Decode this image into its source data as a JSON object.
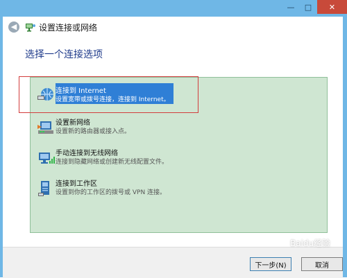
{
  "window": {
    "controls": {
      "minimize": "—",
      "maximize": "□",
      "close": "✕"
    }
  },
  "header": {
    "back_icon": "back-arrow-icon",
    "title": "设置连接或网络"
  },
  "heading": "选择一个连接选项",
  "options": [
    {
      "title": "连接到 Internet",
      "desc": "设置宽带或拨号连接，连接到 Internet。",
      "icon": "globe-network-icon",
      "selected": true
    },
    {
      "title": "设置新网络",
      "desc": "设置新的路由器或接入点。",
      "icon": "router-icon",
      "selected": false
    },
    {
      "title": "手动连接到无线网络",
      "desc": "连接到隐藏网络或创建新无线配置文件。",
      "icon": "wireless-computer-icon",
      "selected": false
    },
    {
      "title": "连接到工作区",
      "desc": "设置到你的工作区的拨号或 VPN 连接。",
      "icon": "workplace-icon",
      "selected": false
    }
  ],
  "buttons": {
    "next": "下一步(N)",
    "cancel": "取消"
  },
  "watermark": "Baidu经验"
}
